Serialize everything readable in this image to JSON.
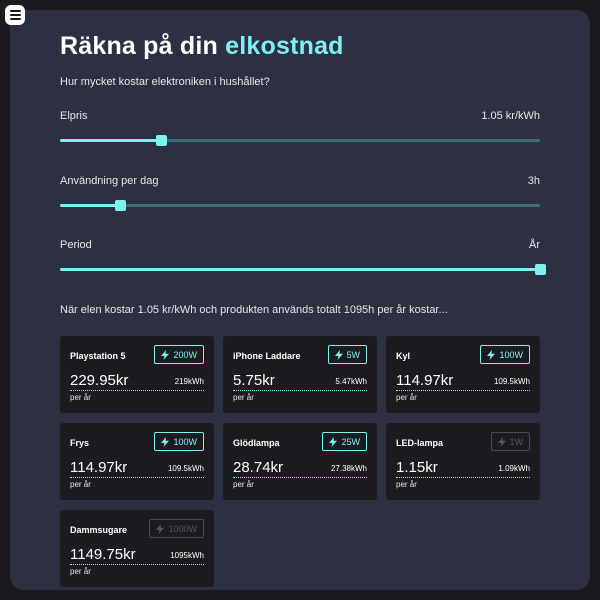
{
  "header": {
    "title_main": "Räkna på din",
    "title_accent": "elkostnad",
    "subtitle": "Hur mycket kostar elektroniken i hushållet?"
  },
  "sliders": [
    {
      "label": "Elpris",
      "value": "1.05 kr/kWh",
      "fraction": 0.21
    },
    {
      "label": "Användning per dag",
      "value": "3h",
      "fraction": 0.125
    },
    {
      "label": "Period",
      "value": "År",
      "fraction": 1.0
    }
  ],
  "summary": "När elen kostar 1.05 kr/kWh och produkten används totalt 1095h per år kostar...",
  "products": [
    {
      "name": "Playstation 5",
      "watt": "200W",
      "cost": "229.95kr",
      "kwh": "219kWh",
      "per": "per år",
      "active": true
    },
    {
      "name": "iPhone Laddare",
      "watt": "5W",
      "cost": "5.75kr",
      "kwh": "5.47kWh",
      "per": "per år",
      "active": true
    },
    {
      "name": "Kyl",
      "watt": "100W",
      "cost": "114.97kr",
      "kwh": "109.5kWh",
      "per": "per år",
      "active": true
    },
    {
      "name": "Frys",
      "watt": "100W",
      "cost": "114.97kr",
      "kwh": "109.5kWh",
      "per": "per år",
      "active": true
    },
    {
      "name": "Glödlampa",
      "watt": "25W",
      "cost": "28.74kr",
      "kwh": "27.38kWh",
      "per": "per år",
      "active": true
    },
    {
      "name": "LED-lampa",
      "watt": "1W",
      "cost": "1.15kr",
      "kwh": "1.09kWh",
      "per": "per år",
      "active": false
    },
    {
      "name": "Dammsugare",
      "watt": "1000W",
      "cost": "1149.75kr",
      "kwh": "1095kWh",
      "per": "per år",
      "active": false
    }
  ],
  "colors": {
    "accent": "#7df0f2",
    "panel": "#2d2f42",
    "card": "#1c1c20",
    "track": "#3c6f7e"
  },
  "icons": {
    "menu": "hamburger-menu-icon",
    "badge": "lightning-bolt-icon"
  }
}
